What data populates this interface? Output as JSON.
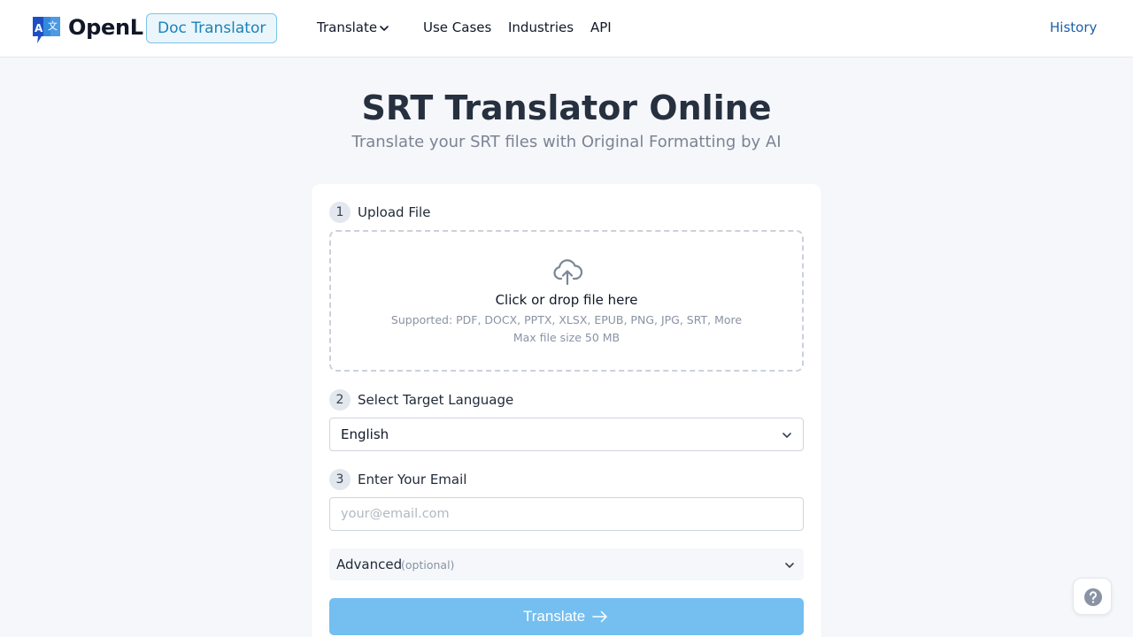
{
  "header": {
    "logo_text": "OpenL",
    "logo_glyph_left": "A",
    "logo_glyph_right": "文",
    "badge": "Doc Translator",
    "nav": {
      "translate": "Translate",
      "use_cases": "Use Cases",
      "industries": "Industries",
      "api": "API"
    },
    "history": "History"
  },
  "hero": {
    "title": "SRT Translator Online",
    "subtitle": "Translate your SRT files with Original Formatting by AI"
  },
  "form": {
    "step1": {
      "num": "1",
      "label": "Upload File"
    },
    "dropzone": {
      "main": "Click or drop file here",
      "supported": "Supported: PDF, DOCX, PPTX, XLSX, EPUB, PNG, JPG, SRT, More",
      "max_size": "Max file size 50 MB"
    },
    "step2": {
      "num": "2",
      "label": "Select Target Language"
    },
    "language_selected": "English",
    "step3": {
      "num": "3",
      "label": "Enter Your Email"
    },
    "email": {
      "value": "",
      "placeholder": "your@email.com"
    },
    "advanced": {
      "label": "Advanced",
      "optional": "(optional)"
    },
    "submit_label": "Translate"
  },
  "colors": {
    "accent": "#74bff0",
    "brand_blue": "#1b82b8",
    "link": "#1e5fa8",
    "title": "#27303f"
  },
  "icons": {
    "translate_chevron": "chevron-down-icon",
    "upload": "cloud-upload-icon",
    "select": "chevron-down-icon",
    "advanced": "chevron-down-icon",
    "submit": "arrow-right-icon",
    "help": "question-circle-icon"
  }
}
